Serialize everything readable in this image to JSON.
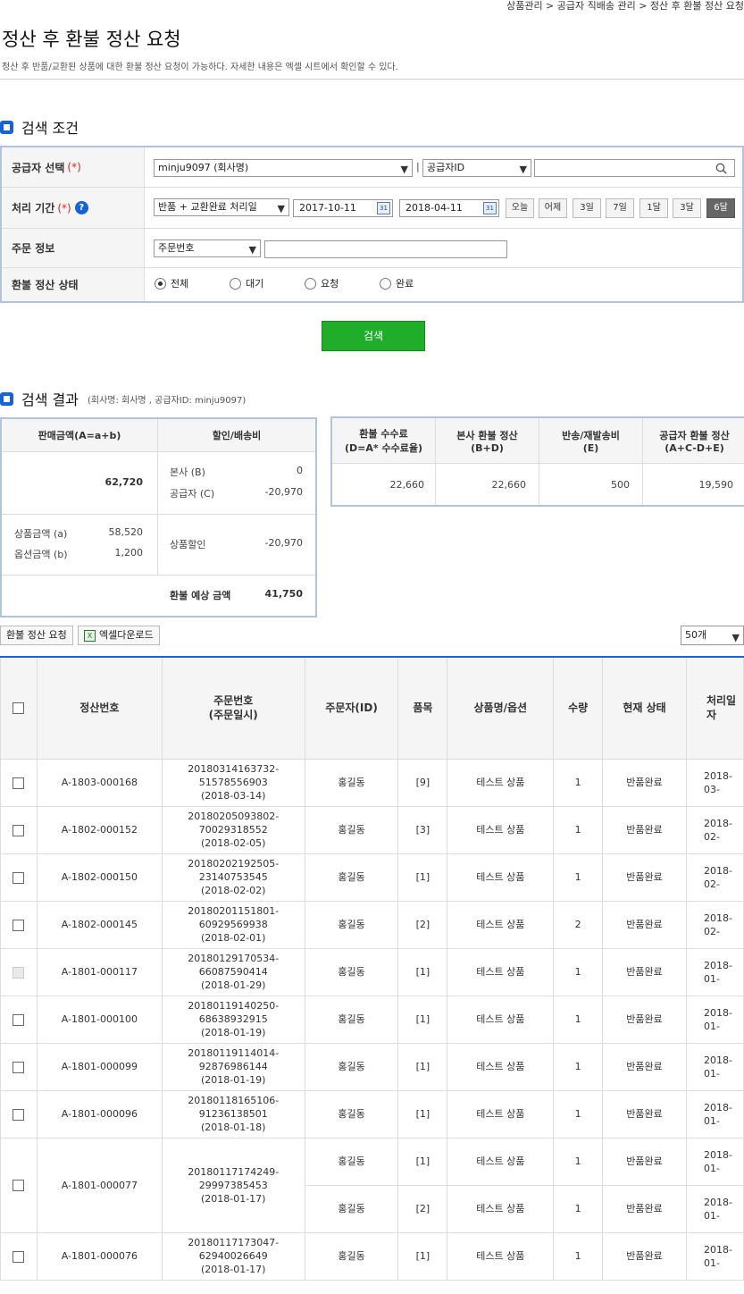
{
  "breadcrumb": "상품관리 > 공급자 직배송 관리 > 정산 후 환불 정산 요청",
  "title": "정산 후 환불 정산 요청",
  "description": "정산 후 반품/교환된 상품에 대한 환불 정산 요청이 가능하다. 자세한 내용은 엑셀 시트에서 확인할 수 있다.",
  "search_section": {
    "title": "검색 조건",
    "supplier_label": "공급자 선택",
    "required_mark": "(*)",
    "supplier_select": "minju9097 (회사명)",
    "id_type_select": "공급자ID",
    "search_input": "",
    "period_label": "처리 기간",
    "help_mark": "?",
    "period_type": "반품 + 교환완료 처리일",
    "date_from": "2017-10-11",
    "date_to": "2018-04-11",
    "calendar_day": "31",
    "quick_ranges": [
      "오늘",
      "어제",
      "3일",
      "7일",
      "1달",
      "3달",
      "6달"
    ],
    "order_label": "주문 정보",
    "order_type": "주문번호",
    "order_input": "",
    "status_label": "환불 정산 상태",
    "status_options": [
      "전체",
      "대기",
      "요청",
      "완료"
    ],
    "search_button": "검색",
    "separator": "|"
  },
  "result_section": {
    "title": "검색 결과",
    "subtitle": "(회사명: 회사명 , 공급자ID: minju9097)"
  },
  "summary": {
    "sales_header": "판매금액(A=a+b)",
    "sales_total": "62,720",
    "product_amount_label": "상품금액 (a)",
    "product_amount": "58,520",
    "option_amount_label": "옵션금액 (b)",
    "option_amount": "1,200",
    "discount_header": "할인/배송비",
    "hq_label": "본사 (B)",
    "hq_value": "0",
    "supplier_label": "공급자 (C)",
    "supplier_value": "-20,970",
    "product_discount_label": "상품할인",
    "product_discount": "-20,970",
    "expected_label": "환불 예상 금액",
    "expected_value": "41,750"
  },
  "summary2": {
    "headers": [
      "환불 수수료\n(D=A* 수수료율)",
      "본사 환불 정산\n(B+D)",
      "반송/재발송비\n(E)",
      "공급자 환불 정산\n(A+C-D+E)"
    ],
    "values": [
      "22,660",
      "22,660",
      "500",
      "19,590"
    ]
  },
  "toolbar": {
    "refund_request": "환불 정산 요청",
    "excel_download": "엑셀다운로드",
    "excel_icon": "X",
    "page_size": "50개"
  },
  "table": {
    "headers": [
      "정산번호",
      "주문번호\n(주문일시)",
      "주문자(ID)",
      "품목",
      "상품명/옵션",
      "수량",
      "현재 상태",
      "처리일자"
    ],
    "rows": [
      {
        "no": "A-1803-000168",
        "order": "20180314163732-51578556903",
        "date": "(2018-03-14)",
        "buyer": "홍길동",
        "item": "[9]",
        "product": "테스트 상품",
        "qty": "1",
        "status": "반품완료",
        "proc": "2018-03-",
        "disabled": false
      },
      {
        "no": "A-1802-000152",
        "order": "20180205093802-70029318552",
        "date": "(2018-02-05)",
        "buyer": "홍길동",
        "item": "[3]",
        "product": "테스트 상품",
        "qty": "1",
        "status": "반품완료",
        "proc": "2018-02-",
        "disabled": false
      },
      {
        "no": "A-1802-000150",
        "order": "20180202192505-23140753545",
        "date": "(2018-02-02)",
        "buyer": "홍길동",
        "item": "[1]",
        "product": "테스트 상품",
        "qty": "1",
        "status": "반품완료",
        "proc": "2018-02-",
        "disabled": false
      },
      {
        "no": "A-1802-000145",
        "order": "20180201151801-60929569938",
        "date": "(2018-02-01)",
        "buyer": "홍길동",
        "item": "[2]",
        "product": "테스트 상품",
        "qty": "2",
        "status": "반품완료",
        "proc": "2018-02-",
        "disabled": false
      },
      {
        "no": "A-1801-000117",
        "order": "20180129170534-66087590414",
        "date": "(2018-01-29)",
        "buyer": "홍길동",
        "item": "[1]",
        "product": "테스트 상품",
        "qty": "1",
        "status": "반품완료",
        "proc": "2018-01-",
        "disabled": true
      },
      {
        "no": "A-1801-000100",
        "order": "20180119140250-68638932915",
        "date": "(2018-01-19)",
        "buyer": "홍길동",
        "item": "[1]",
        "product": "테스트 상품",
        "qty": "1",
        "status": "반품완료",
        "proc": "2018-01-",
        "disabled": false
      },
      {
        "no": "A-1801-000099",
        "order": "20180119114014-92876986144",
        "date": "(2018-01-19)",
        "buyer": "홍길동",
        "item": "[1]",
        "product": "테스트 상품",
        "qty": "1",
        "status": "반품완료",
        "proc": "2018-01-",
        "disabled": false
      },
      {
        "no": "A-1801-000096",
        "order": "20180118165106-91236138501",
        "date": "(2018-01-18)",
        "buyer": "홍길동",
        "item": "[1]",
        "product": "테스트 상품",
        "qty": "1",
        "status": "반품완료",
        "proc": "2018-01-",
        "disabled": false
      }
    ],
    "multi_row": {
      "no": "A-1801-000077",
      "order": "20180117174249-29997385453",
      "date": "(2018-01-17)",
      "lines": [
        {
          "buyer": "홍길동",
          "item": "[1]",
          "product": "테스트 상품",
          "qty": "1",
          "status": "반품완료",
          "proc": "2018-01-"
        },
        {
          "buyer": "홍길동",
          "item": "[2]",
          "product": "테스트 상품",
          "qty": "1",
          "status": "반품완료",
          "proc": "2018-01-"
        }
      ]
    },
    "last_row": {
      "no": "A-1801-000076",
      "order": "20180117173047-62940026649",
      "date": "(2018-01-17)",
      "buyer": "홍길동",
      "item": "[1]",
      "product": "테스트 상품",
      "qty": "1",
      "status": "반품완료",
      "proc": "2018-01-",
      "disabled": false
    }
  }
}
